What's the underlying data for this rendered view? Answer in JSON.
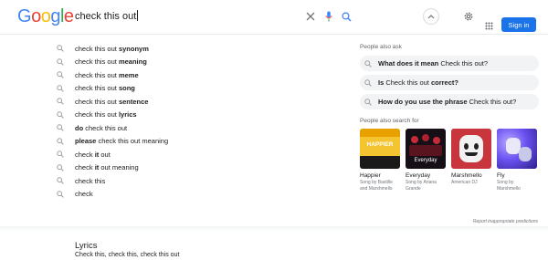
{
  "header": {
    "logo": "Google",
    "query": "check this out",
    "sign_in_label": "Sign in"
  },
  "suggestions": [
    {
      "prefix": "check this out ",
      "bold": "synonym",
      "suffix": ""
    },
    {
      "prefix": "check this out ",
      "bold": "meaning",
      "suffix": ""
    },
    {
      "prefix": "check this out ",
      "bold": "meme",
      "suffix": ""
    },
    {
      "prefix": "check this out ",
      "bold": "song",
      "suffix": ""
    },
    {
      "prefix": "check this out ",
      "bold": "sentence",
      "suffix": ""
    },
    {
      "prefix": "check this out ",
      "bold": "lyrics",
      "suffix": ""
    },
    {
      "prefix": "",
      "bold": "do",
      "suffix": " check this out"
    },
    {
      "prefix": "",
      "bold": "please",
      "suffix": " check this out meaning"
    },
    {
      "prefix": "check ",
      "bold": "it",
      "suffix": " out"
    },
    {
      "prefix": "check ",
      "bold": "it",
      "suffix": " out meaning"
    },
    {
      "prefix": "check this",
      "bold": "",
      "suffix": ""
    },
    {
      "prefix": "check",
      "bold": "",
      "suffix": ""
    }
  ],
  "people_also_ask": {
    "title": "People also ask",
    "items": [
      {
        "bold": "What does it mean",
        "rest": " Check this out?",
        "bold_after": ""
      },
      {
        "bold": "Is",
        "rest": " Check this out ",
        "bold_after": "correct?"
      },
      {
        "bold": "How do you use the phrase",
        "rest": " Check this out?",
        "bold_after": ""
      }
    ]
  },
  "people_also_search": {
    "title": "People also search for",
    "cards": [
      {
        "name": "Happier",
        "sub": "Song by Bastille and Marshmello",
        "thumb_text": "HAPPIER"
      },
      {
        "name": "Everyday",
        "sub": "Song by Ariana Grande",
        "thumb_text": "Everyday"
      },
      {
        "name": "Marshmello",
        "sub": "American DJ",
        "thumb_text": ""
      },
      {
        "name": "Fly",
        "sub": "Song by Marshmello",
        "thumb_text": ""
      }
    ]
  },
  "report_link": "Report inappropriate predictions",
  "lyrics": {
    "title": "Lyrics",
    "line": "Check this, check this, check this out"
  },
  "colors": {
    "accent": "#1a73e8",
    "chip_bg": "#f1f3f4",
    "text": "#202124",
    "muted": "#70757a"
  }
}
